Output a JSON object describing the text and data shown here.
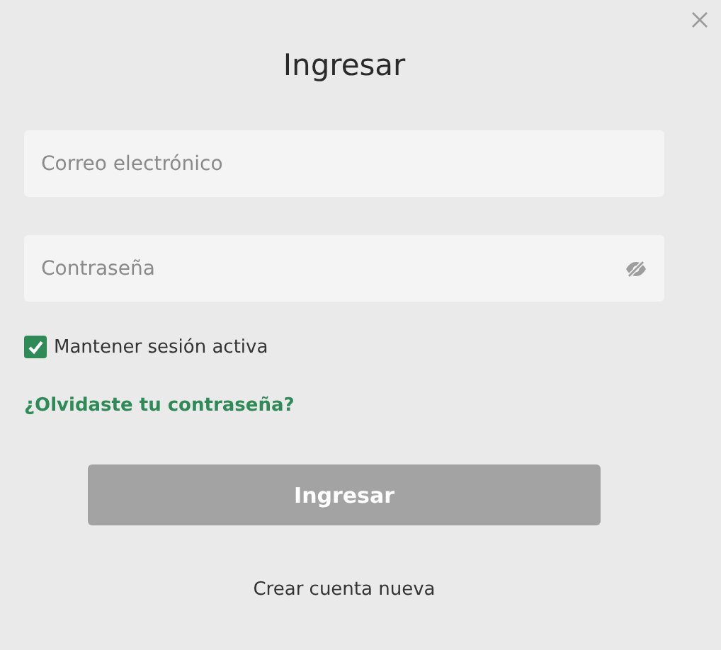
{
  "dialog": {
    "title": "Ingresar",
    "fields": [
      {
        "kind": "email",
        "placeholder": "Correo electrónico"
      },
      {
        "kind": "password",
        "placeholder": "Contraseña"
      }
    ],
    "remember": {
      "label": "Mantener sesión activa",
      "checked": true
    },
    "forgot_link": "¿Olvidaste tu contraseña?",
    "submit": {
      "label": "Ingresar",
      "disabled": true
    },
    "create_account": "Crear cuenta nueva"
  }
}
